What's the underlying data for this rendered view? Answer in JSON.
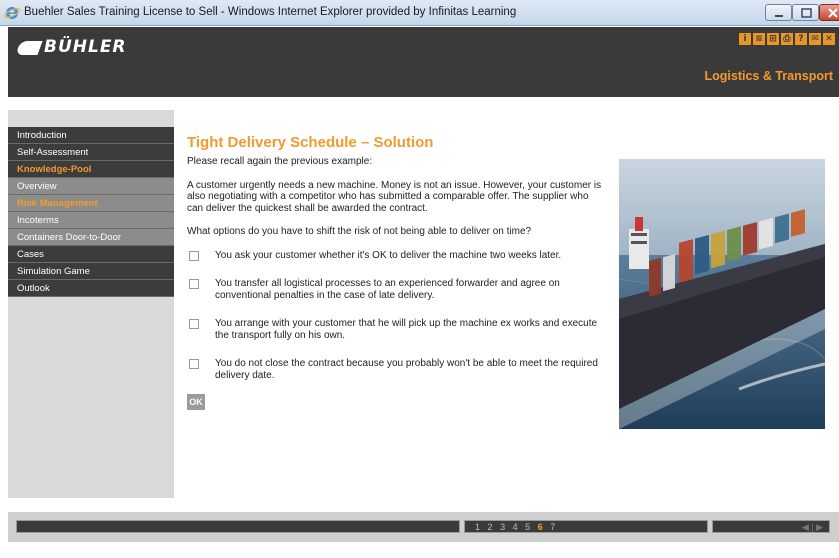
{
  "window": {
    "title": "Buehler Sales Training License to Sell - Windows Internet Explorer provided by Infinitas Learning"
  },
  "header": {
    "logo_text": "BÜHLER",
    "section_title": "Logistics & Transport",
    "toolbar_icons": [
      "info-icon",
      "list-icon",
      "sitemap-icon",
      "print-icon",
      "help-icon",
      "mail-icon",
      "close-icon"
    ],
    "toolbar_glyphs": [
      "i",
      "≡",
      "⊞",
      "⎙",
      "?",
      "✉",
      "✕"
    ]
  },
  "sidebar": {
    "items": [
      {
        "label": "Introduction",
        "type": "main"
      },
      {
        "label": "Self-Assessment",
        "type": "main"
      },
      {
        "label": "Knowledge-Pool",
        "type": "active"
      },
      {
        "label": "Overview",
        "type": "sub"
      },
      {
        "label": "Risk Management",
        "type": "current"
      },
      {
        "label": "Incoterms",
        "type": "sub"
      },
      {
        "label": "Containers Door-to-Door",
        "type": "sub"
      },
      {
        "label": "Cases",
        "type": "main"
      },
      {
        "label": "Simulation Game",
        "type": "main"
      },
      {
        "label": "Outlook",
        "type": "main"
      }
    ]
  },
  "main": {
    "heading": "Tight Delivery Schedule – Solution",
    "intro": "Please recall again the previous example:",
    "scenario": "A customer urgently needs a new machine. Money is not an issue. However, your customer is also negotiating with a competitor who has submitted a comparable offer. The supplier who can deliver the quickest shall be awarded the contract.",
    "question": "What options do you have to shift the risk of not being able to deliver on time?",
    "options": [
      "You ask your customer whether it's OK to deliver the machine two weeks later.",
      "You transfer all logistical processes to an experienced forwarder and agree on conventional penalties in the case of late delivery.",
      "You arrange with your customer that he will pick up the machine ex works and execute the transport fully on his own.",
      "You do not close the contract because you probably won't be able to meet the required delivery date."
    ],
    "ok_label": "OK"
  },
  "footer": {
    "pages": [
      "1",
      "2",
      "3",
      "4",
      "5",
      "6",
      "7"
    ],
    "current_page": "6",
    "nav_arrows": "◀ | ▶"
  },
  "colors": {
    "accent": "#f39a2e",
    "header_bg": "#3a3a3a",
    "sidebar_bg": "#d9d9d9"
  }
}
